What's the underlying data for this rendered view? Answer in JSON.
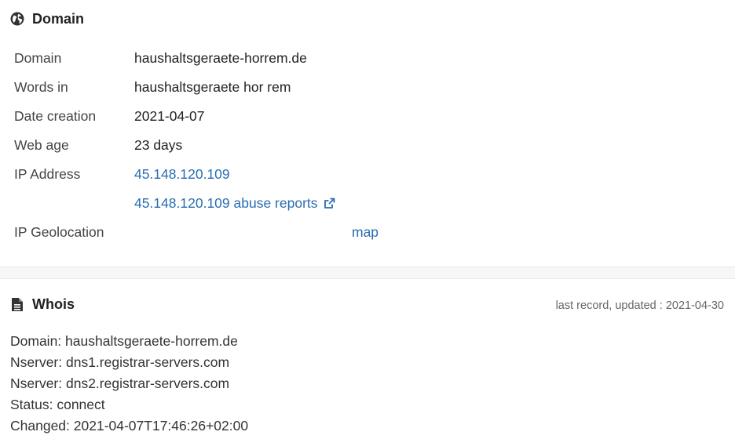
{
  "domain_section": {
    "icon": "globe-icon",
    "title": "Domain",
    "rows": {
      "domain": {
        "label": "Domain",
        "value": "haushaltsgeraete-horrem.de"
      },
      "words": {
        "label": "Words in",
        "value": "haushaltsgeraete hor rem"
      },
      "date_creation": {
        "label": "Date creation",
        "value": "2021-04-07"
      },
      "web_age": {
        "label": "Web age",
        "value": "23 days"
      },
      "ip_address": {
        "label": "IP Address",
        "value": "45.148.120.109"
      },
      "abuse": {
        "value": "45.148.120.109 abuse reports",
        "icon": "external-link-icon"
      },
      "geolocation": {
        "label": "IP Geolocation",
        "link": "map"
      }
    }
  },
  "whois_section": {
    "icon": "document-icon",
    "title": "Whois",
    "updated": "last record, updated : 2021-04-30",
    "lines": [
      "Domain: haushaltsgeraete-horrem.de",
      "Nserver: dns1.registrar-servers.com",
      "Nserver: dns2.registrar-servers.com",
      "Status: connect",
      "Changed: 2021-04-07T17:46:26+02:00"
    ]
  },
  "colors": {
    "link": "#2a6db1",
    "heading": "#222222",
    "divider": "#f7f7f7"
  }
}
